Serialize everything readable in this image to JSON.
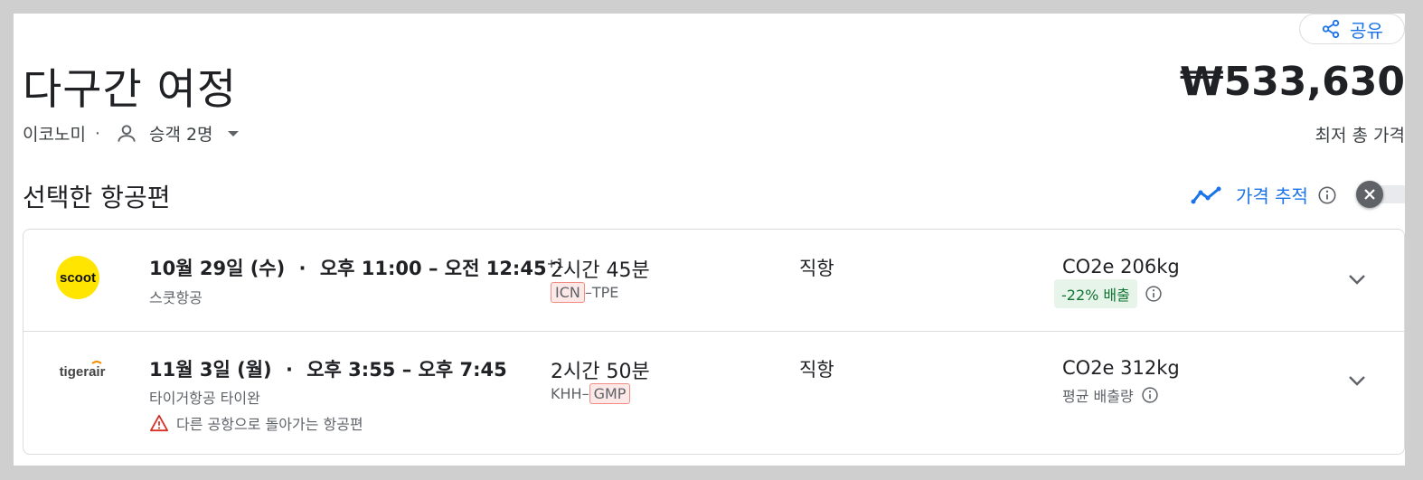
{
  "header": {
    "share_label": "공유",
    "title": "다구간 여정",
    "price": "₩533,630",
    "price_label": "최저 총 가격",
    "cabin_class": "이코노미",
    "separator": "·",
    "passengers": "승객 2명"
  },
  "section": {
    "title": "선택한 항공편",
    "track_label": "가격 추적"
  },
  "colors": {
    "accent": "#1a73e8",
    "highlight_bg": "#fce8e6",
    "badge_bg": "#e6f4ea",
    "badge_fg": "#137333",
    "warning": "#d93025"
  },
  "flights": [
    {
      "logo_text": "scoot",
      "logo_icon": "scoot-logo",
      "date": "10월 29일 (수)",
      "times": "오후 11:00 – 오전 12:45",
      "day_offset": "+1",
      "airline": "스쿳항공",
      "duration": "2시간 45분",
      "from": "ICN",
      "to": "TPE",
      "dash": "–",
      "stops": "직항",
      "co2": "CO2e 206kg",
      "emissions_note": "-22% 배출"
    },
    {
      "logo_text": "tigerair",
      "logo_icon": "tigerair-logo",
      "date": "11월 3일 (월)",
      "times": "오후 3:55 – 오후 7:45",
      "airline": "타이거항공 타이완",
      "warning": "다른 공항으로 돌아가는 항공편",
      "duration": "2시간 50분",
      "from": "KHH",
      "to": "GMP",
      "dash": "–",
      "stops": "직항",
      "co2": "CO2e 312kg",
      "emissions_note": "평균 배출량"
    }
  ]
}
